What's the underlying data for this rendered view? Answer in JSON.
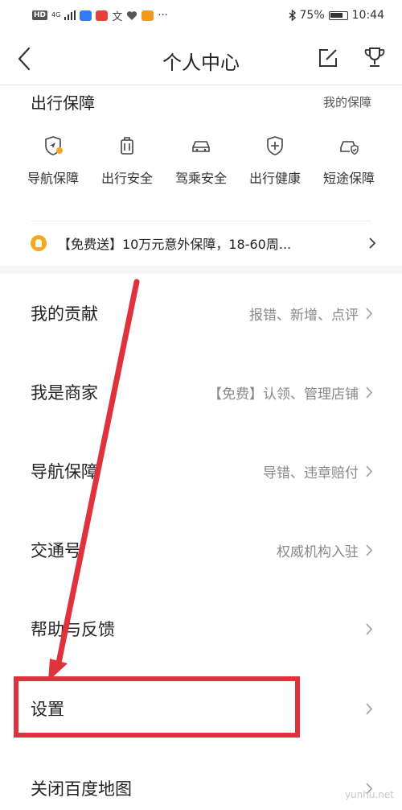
{
  "status_bar": {
    "hd": "HD",
    "network": "4G",
    "battery": "75%",
    "time": "10:44",
    "more": "···"
  },
  "header": {
    "title": "个人中心",
    "icons": [
      "back-icon",
      "edit-icon",
      "trophy-icon"
    ]
  },
  "protection": {
    "title": "出行保障",
    "link": "我的保障",
    "features": [
      {
        "label": "导航保障",
        "icon": "shield-navigation-icon"
      },
      {
        "label": "出行安全",
        "icon": "luggage-icon"
      },
      {
        "label": "驾乘安全",
        "icon": "car-icon"
      },
      {
        "label": "出行健康",
        "icon": "shield-plus-icon"
      },
      {
        "label": "短途保障",
        "icon": "car-shield-icon"
      }
    ],
    "promo": "【免费送】10万元意外保障，18-60周..."
  },
  "menu": [
    {
      "label": "我的贡献",
      "sub": "报错、新增、点评"
    },
    {
      "label": "我是商家",
      "sub": "【免费】认领、管理店铺"
    },
    {
      "label": "导航保障",
      "sub": "导错、违章赔付"
    },
    {
      "label": "交通号",
      "sub": "权威机构入驻"
    },
    {
      "label": "帮助与反馈",
      "sub": ""
    },
    {
      "label": "设置",
      "sub": ""
    },
    {
      "label": "关闭百度地图",
      "sub": ""
    }
  ],
  "watermark": "yunhu.net",
  "colors": {
    "accent": "#f5a623",
    "annotation": "#e0323c"
  }
}
